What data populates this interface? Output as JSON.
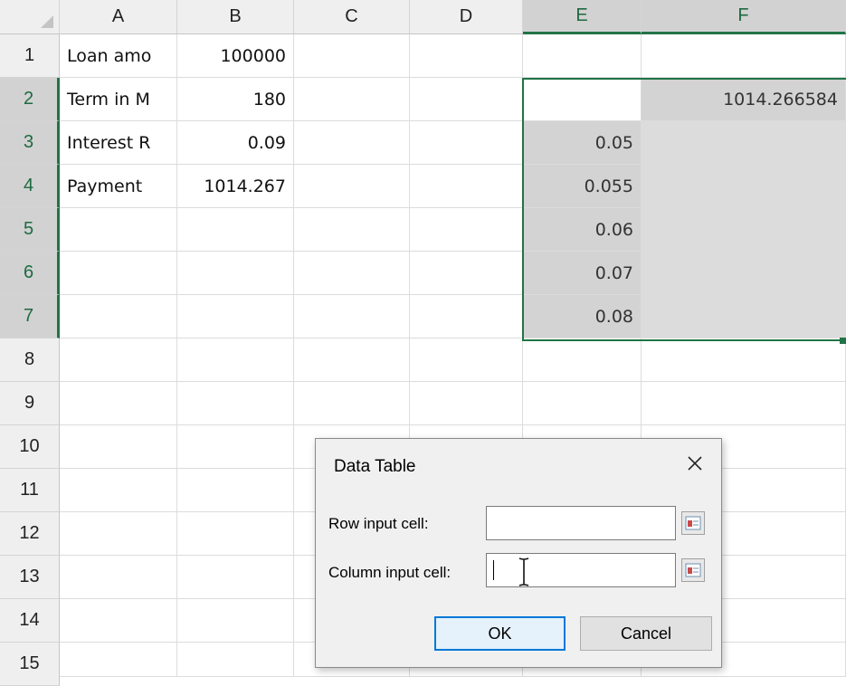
{
  "columns": [
    "A",
    "B",
    "C",
    "D",
    "E",
    "F"
  ],
  "rows": [
    "1",
    "2",
    "3",
    "4",
    "5",
    "6",
    "7",
    "8",
    "9",
    "10",
    "11",
    "12",
    "13",
    "14",
    "15"
  ],
  "cells": {
    "A1": "Loan amo",
    "B1": "100000",
    "A2": "Term in M",
    "B2": "180",
    "A3": "Interest R",
    "B3": "0.09",
    "A4": "Payment",
    "B4": "1014.267",
    "F2": "1014.266584",
    "E3": "0.05",
    "E4": "0.055",
    "E5": "0.06",
    "E6": "0.07",
    "E7": "0.08"
  },
  "dialog": {
    "title": "Data Table",
    "row_input_label": "Row input cell:",
    "row_input_value": "",
    "column_input_label": "Column input cell:",
    "column_input_value": "",
    "ok_label": "OK",
    "cancel_label": "Cancel",
    "close_icon": "close-icon",
    "ref_icon": "collapse-dialog-icon"
  },
  "colors": {
    "accent": "#217346",
    "selection_fill": "#d3d3d3",
    "default_button_border": "#0078d7"
  }
}
